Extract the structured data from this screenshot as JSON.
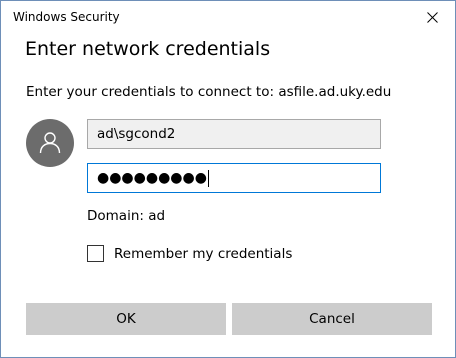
{
  "window": {
    "title": "Windows Security"
  },
  "dialog": {
    "heading": "Enter network credentials",
    "subtitle": "Enter your credentials to connect to: asfile.ad.uky.edu",
    "username_value": "ad\\sgcond2",
    "password_masked": "●●●●●●●●●",
    "domain_text": "Domain: ad",
    "remember_label": "Remember my credentials",
    "remember_checked": false
  },
  "buttons": {
    "ok_label": "OK",
    "cancel_label": "Cancel"
  },
  "icons": {
    "close": "close-icon",
    "avatar": "user-icon"
  },
  "colors": {
    "accent": "#0078d7",
    "avatar_bg": "#6c6c6c",
    "button_bg": "#cccccc",
    "username_bg": "#f0f0f0"
  }
}
